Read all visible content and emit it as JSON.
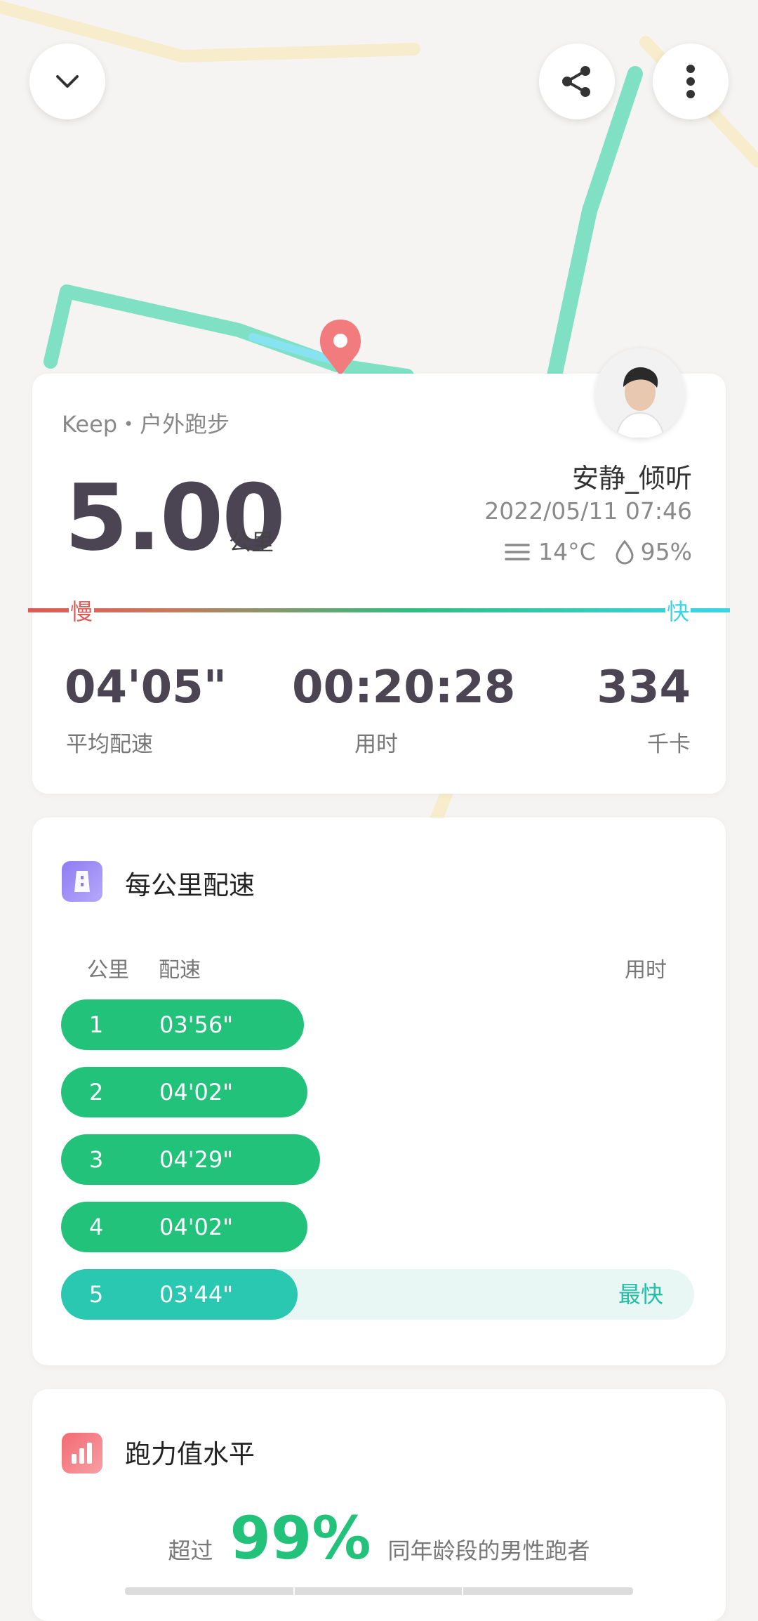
{
  "map": {
    "route_color": "#7fe0c4",
    "marker_color": "#f27b7e"
  },
  "header": {
    "collapse_icon": "chevron-down-icon",
    "share_icon": "share-icon",
    "more_icon": "more-vertical-icon"
  },
  "summary": {
    "source": "Keep・户外跑步",
    "distance": "5.00",
    "distance_unit": "公里",
    "user_name": "安静_倾听",
    "datetime": "2022/05/11 07:46",
    "temperature": "14°C",
    "humidity": "95%",
    "slow_label": "慢",
    "fast_label": "快",
    "stats": [
      {
        "value": "04'05\"",
        "label": "平均配速"
      },
      {
        "value": "00:20:28",
        "label": "用时"
      },
      {
        "value": "334",
        "label": "千卡"
      }
    ]
  },
  "splits": {
    "title": "每公里配速",
    "col_km": "公里",
    "col_pace": "配速",
    "col_time": "用时",
    "fastest_label": "最快",
    "rows": [
      {
        "km": "1",
        "pace": "03'56\"",
        "bar_fraction": 0.384,
        "fastest": false
      },
      {
        "km": "2",
        "pace": "04'02\"",
        "bar_fraction": 0.389,
        "fastest": false
      },
      {
        "km": "3",
        "pace": "04'29\"",
        "bar_fraction": 0.409,
        "fastest": false
      },
      {
        "km": "4",
        "pace": "04'02\"",
        "bar_fraction": 0.389,
        "fastest": false
      },
      {
        "km": "5",
        "pace": "03'44\"",
        "bar_fraction": 0.374,
        "fastest": true
      }
    ]
  },
  "level": {
    "title": "跑力值水平",
    "prefix": "超过",
    "percent": "99%",
    "suffix": "同年龄段的男性跑者"
  },
  "colors": {
    "accent_green": "#22c27b",
    "fastest_teal": "#2ac8b0",
    "slow_red": "#e05a56",
    "fast_cyan": "#3ad6e8",
    "text_dark": "#4b4453"
  }
}
